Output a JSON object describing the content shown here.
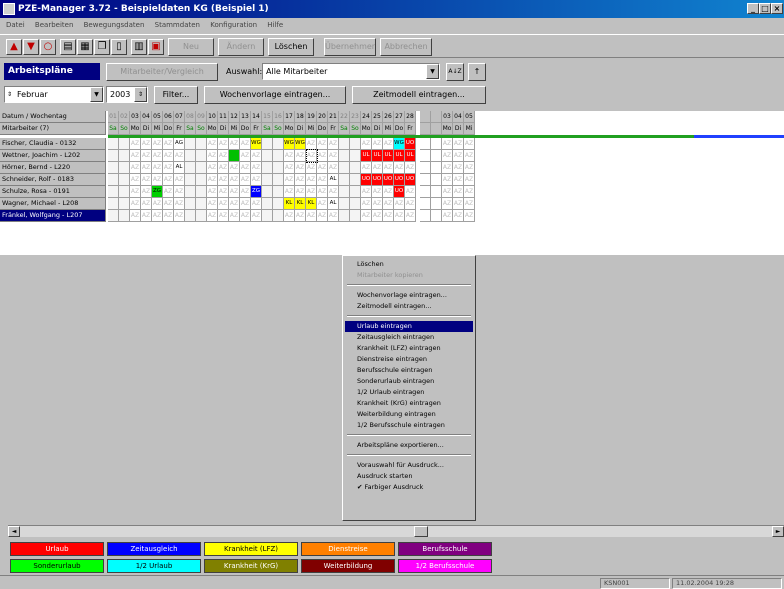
{
  "window": {
    "title": "PZE-Manager 3.72 - Beispieldaten KG (Beispiel 1)",
    "min": "_",
    "max": "□",
    "close": "×"
  },
  "menu": [
    "Datei",
    "Bearbeiten",
    "Bewegungsdaten",
    "Stammdaten",
    "Konfiguration",
    "Hilfe"
  ],
  "toolbar": {
    "icons": [
      "arrow-up-icon",
      "arrow-down-icon",
      "circle-icon",
      "print-icon",
      "calendar-icon",
      "copy-icon",
      "page-icon",
      "book-icon",
      "calculator-icon"
    ],
    "buttons": [
      {
        "label": "Neu",
        "enabled": false
      },
      {
        "label": "Ändern",
        "enabled": false
      },
      {
        "label": "Löschen",
        "enabled": true
      },
      {
        "label": "Übernehmen",
        "enabled": false
      },
      {
        "label": "Abbrechen",
        "enabled": false
      }
    ]
  },
  "panel": {
    "title": "Arbeitspläne",
    "mode_button": "Mitarbeiter/Vergleich",
    "auswahl_label": "Auswahl:",
    "auswahl_value": "Alle Mitarbeiter",
    "sort1": "A↓Z",
    "sort2": "↑"
  },
  "controls": {
    "month": "Februar",
    "year": "2003",
    "filter": "Filter...",
    "wochenvorlage": "Wochenvorlage eintragen...",
    "zeitmodell": "Zeitmodell eintragen..."
  },
  "grid": {
    "label_header": "Datum / Wochentag",
    "label_sub": "Mitarbeiter (7)",
    "days": [
      "01",
      "02",
      "03",
      "04",
      "05",
      "06",
      "07",
      "08",
      "09",
      "10",
      "11",
      "12",
      "13",
      "14",
      "15",
      "16",
      "17",
      "18",
      "19",
      "20",
      "21",
      "22",
      "23",
      "24",
      "25",
      "26",
      "27",
      "28",
      "",
      "",
      "03",
      "04",
      "05"
    ],
    "weekdays": [
      "Sa",
      "So",
      "Mo",
      "Di",
      "Mi",
      "Do",
      "Fr",
      "Sa",
      "So",
      "Mo",
      "Di",
      "Mi",
      "Do",
      "Fr",
      "Sa",
      "So",
      "Mo",
      "Di",
      "Mi",
      "Do",
      "Fr",
      "Sa",
      "So",
      "Mo",
      "Di",
      "Mi",
      "Do",
      "Fr",
      "",
      "",
      "Mo",
      "Di",
      "Mi"
    ],
    "employees": [
      "Fischer, Claudia - 0132",
      "Wettner, Joachim - L202",
      "Hörner, Bernd - L220",
      "Schneider, Rolf - 0183",
      "Schulze, Rosa - 0191",
      "Wagner, Michael - L208",
      "Fränkel, Wolfgang - L207"
    ],
    "cells": [
      {
        "row": 0,
        "col": 6,
        "text": "AG",
        "color": ""
      },
      {
        "row": 0,
        "col": 13,
        "text": "WG",
        "color": "#ffff00"
      },
      {
        "row": 0,
        "col": 16,
        "text": "WG",
        "color": "#ffff00"
      },
      {
        "row": 0,
        "col": 17,
        "text": "WG",
        "color": "#ffff00"
      },
      {
        "row": 0,
        "col": 26,
        "text": "WG",
        "color": "#00ffff"
      },
      {
        "row": 0,
        "col": 27,
        "text": "UO",
        "color": "#ff0000"
      },
      {
        "row": 1,
        "col": 11,
        "text": "",
        "color": "#00c000"
      },
      {
        "row": 1,
        "col": 23,
        "text": "UL",
        "color": "#ff0000"
      },
      {
        "row": 1,
        "col": 24,
        "text": "UL",
        "color": "#ff0000"
      },
      {
        "row": 1,
        "col": 25,
        "text": "UL",
        "color": "#ff0000"
      },
      {
        "row": 1,
        "col": 26,
        "text": "UL",
        "color": "#ff0000"
      },
      {
        "row": 1,
        "col": 27,
        "text": "UL",
        "color": "#ff0000"
      },
      {
        "row": 2,
        "col": 6,
        "text": "AL",
        "color": ""
      },
      {
        "row": 3,
        "col": 20,
        "text": "AL",
        "color": ""
      },
      {
        "row": 3,
        "col": 23,
        "text": "UO",
        "color": "#ff0000"
      },
      {
        "row": 3,
        "col": 24,
        "text": "UO",
        "color": "#ff0000"
      },
      {
        "row": 3,
        "col": 25,
        "text": "UO",
        "color": "#ff0000"
      },
      {
        "row": 3,
        "col": 26,
        "text": "UO",
        "color": "#ff0000"
      },
      {
        "row": 3,
        "col": 27,
        "text": "UO",
        "color": "#ff0000"
      },
      {
        "row": 4,
        "col": 4,
        "text": "ZG",
        "color": "#00d000"
      },
      {
        "row": 4,
        "col": 13,
        "text": "ZG",
        "color": "#0000ff"
      },
      {
        "row": 4,
        "col": 26,
        "text": "UO",
        "color": "#ff0000"
      },
      {
        "row": 5,
        "col": 16,
        "text": "KL",
        "color": "#ffff00"
      },
      {
        "row": 5,
        "col": 17,
        "text": "KL",
        "color": "#ffff00"
      },
      {
        "row": 5,
        "col": 18,
        "text": "KL",
        "color": "#ffff00"
      },
      {
        "row": 5,
        "col": 20,
        "text": "AL",
        "color": ""
      }
    ]
  },
  "context_menu": [
    {
      "type": "item",
      "label": "Löschen",
      "enabled": true
    },
    {
      "type": "item",
      "label": "Mitarbeiter kopieren",
      "enabled": false
    },
    {
      "type": "sep"
    },
    {
      "type": "item",
      "label": "Wochenvorlage eintragen...",
      "enabled": true
    },
    {
      "type": "item",
      "label": "Zeitmodell eintragen...",
      "enabled": true
    },
    {
      "type": "sep"
    },
    {
      "type": "item",
      "label": "Urlaub eintragen",
      "enabled": true,
      "highlight": true
    },
    {
      "type": "item",
      "label": "Zeitausgleich eintragen",
      "enabled": true
    },
    {
      "type": "item",
      "label": "Krankheit (LFZ) eintragen",
      "enabled": true
    },
    {
      "type": "item",
      "label": "Dienstreise eintragen",
      "enabled": true
    },
    {
      "type": "item",
      "label": "Berufsschule eintragen",
      "enabled": true
    },
    {
      "type": "item",
      "label": "Sonderurlaub eintragen",
      "enabled": true
    },
    {
      "type": "item",
      "label": "1/2 Urlaub eintragen",
      "enabled": true
    },
    {
      "type": "item",
      "label": "Krankheit (KrG) eintragen",
      "enabled": true
    },
    {
      "type": "item",
      "label": "Weiterbildung eintragen",
      "enabled": true
    },
    {
      "type": "item",
      "label": "1/2 Berufsschule eintragen",
      "enabled": true
    },
    {
      "type": "sep"
    },
    {
      "type": "item",
      "label": "Arbeitspläne exportieren...",
      "enabled": true
    },
    {
      "type": "sep"
    },
    {
      "type": "item",
      "label": "Vorauswahl für Ausdruck...",
      "enabled": true
    },
    {
      "type": "item",
      "label": "Ausdruck starten",
      "enabled": true
    },
    {
      "type": "item",
      "label": "✔ Farbiger Ausdruck",
      "enabled": true
    }
  ],
  "legend": [
    {
      "label": "Urlaub",
      "bg": "#ff0000",
      "fg": "#ffffff"
    },
    {
      "label": "Zeitausgleich",
      "bg": "#0000ff",
      "fg": "#ffffff"
    },
    {
      "label": "Krankheit (LFZ)",
      "bg": "#ffff00",
      "fg": "#000000"
    },
    {
      "label": "Dienstreise",
      "bg": "#ff8000",
      "fg": "#ffffff"
    },
    {
      "label": "Berufsschule",
      "bg": "#800080",
      "fg": "#ffffff"
    },
    {
      "label": "Sonderurlaub",
      "bg": "#00ff00",
      "fg": "#000000"
    },
    {
      "label": "1/2 Urlaub",
      "bg": "#00ffff",
      "fg": "#000000"
    },
    {
      "label": "Krankheit (KrG)",
      "bg": "#808000",
      "fg": "#ffffff"
    },
    {
      "label": "Weiterbildung",
      "bg": "#800000",
      "fg": "#ffffff"
    },
    {
      "label": "1/2 Berufsschule",
      "bg": "#ff00ff",
      "fg": "#ffffff"
    }
  ],
  "status": {
    "user": "KSN001",
    "datetime": "11.02.2004 19:28"
  }
}
